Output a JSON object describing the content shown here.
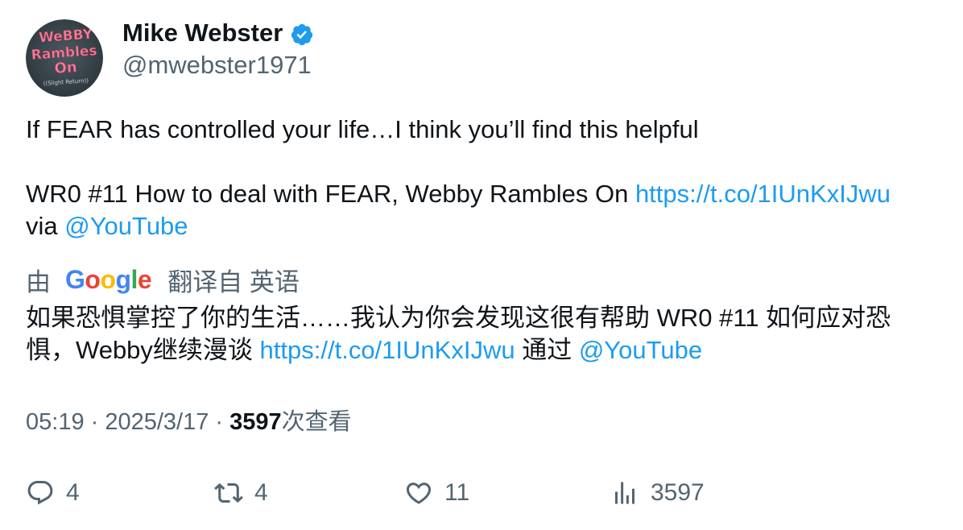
{
  "author": {
    "name": "Mike Webster",
    "handle": "@mwebster1971",
    "avatar_text": [
      "WeBBY",
      "Rambles",
      "On",
      "((Slight Return))"
    ]
  },
  "tweet": {
    "line1": "If FEAR has controlled your life…I think you’ll find this helpful",
    "line2_text": "WR0 #11 How to deal with FEAR, Webby Rambles On ",
    "link": "https://t.co/1IUnKxIJwu",
    "line3_text": "via ",
    "mention": "@YouTube"
  },
  "translation": {
    "prefix": "由",
    "suffix": "翻译自 英语",
    "google_letters": [
      "G",
      "o",
      "o",
      "g",
      "l",
      "e"
    ],
    "line1_text": "如果恐惧掌控了你的生活……我认为你会发现这很有帮助 WR0 #11 如何应对恐",
    "line2_text": "惧，Webby继续漫谈 ",
    "link": "https://t.co/1IUnKxIJwu",
    "middle": " 通过 ",
    "mention": "@YouTube"
  },
  "meta": {
    "time": "05:19",
    "sep1": " · ",
    "date": "2025/3/17",
    "sep2": " · ",
    "views": "3597",
    "views_label": "次查看"
  },
  "actions": {
    "replies": "4",
    "reposts": "4",
    "likes": "11",
    "views": "3597"
  },
  "colors": {
    "link": "#1d9bf0",
    "secondary": "#536471",
    "verified": "#1d9bf0",
    "google": [
      "#4285f4",
      "#ea4335",
      "#fbbc05",
      "#4285f4",
      "#34a853",
      "#ea4335"
    ]
  }
}
